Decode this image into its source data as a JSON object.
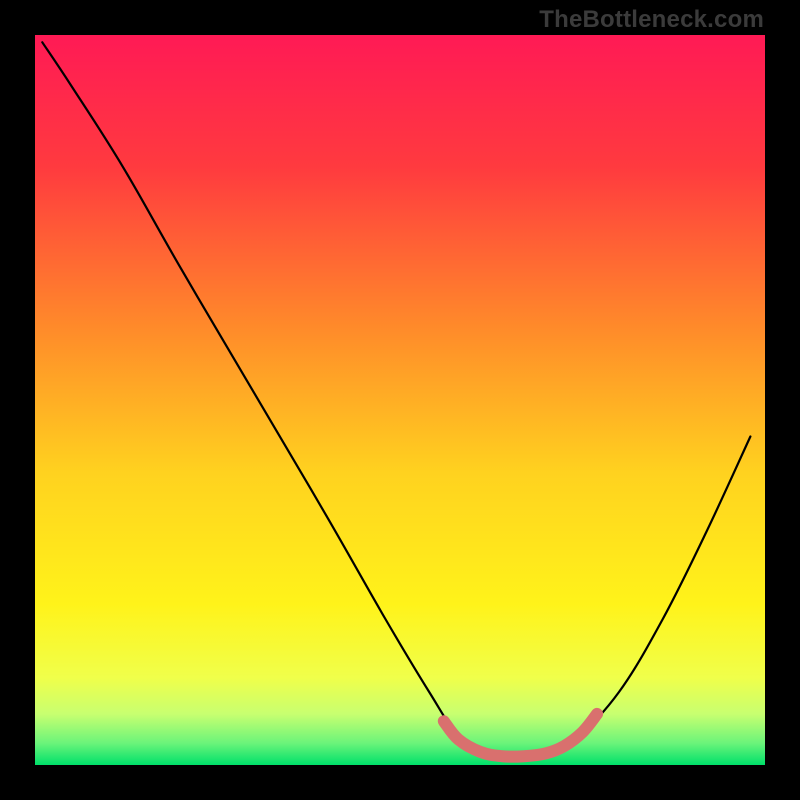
{
  "watermark": "TheBottleneck.com",
  "chart_data": {
    "type": "line",
    "title": "",
    "xlabel": "",
    "ylabel": "",
    "xlim": [
      0,
      100
    ],
    "ylim": [
      0,
      100
    ],
    "gradient_stops": [
      {
        "offset": 0,
        "color": "#ff1a55"
      },
      {
        "offset": 18,
        "color": "#ff3a3f"
      },
      {
        "offset": 40,
        "color": "#ff8a2a"
      },
      {
        "offset": 60,
        "color": "#ffd21f"
      },
      {
        "offset": 78,
        "color": "#fff31a"
      },
      {
        "offset": 88,
        "color": "#f0ff4a"
      },
      {
        "offset": 93,
        "color": "#c8ff70"
      },
      {
        "offset": 97,
        "color": "#6bf47a"
      },
      {
        "offset": 100,
        "color": "#00e06a"
      }
    ],
    "series": [
      {
        "name": "curve",
        "stroke": "#000000",
        "points": [
          {
            "x": 1,
            "y": 99
          },
          {
            "x": 5,
            "y": 93
          },
          {
            "x": 12,
            "y": 82
          },
          {
            "x": 20,
            "y": 68
          },
          {
            "x": 30,
            "y": 51
          },
          {
            "x": 40,
            "y": 34
          },
          {
            "x": 48,
            "y": 20
          },
          {
            "x": 54,
            "y": 10
          },
          {
            "x": 58,
            "y": 4
          },
          {
            "x": 62,
            "y": 1.5
          },
          {
            "x": 66,
            "y": 1
          },
          {
            "x": 70,
            "y": 1.5
          },
          {
            "x": 74,
            "y": 3.5
          },
          {
            "x": 80,
            "y": 10
          },
          {
            "x": 86,
            "y": 20
          },
          {
            "x": 92,
            "y": 32
          },
          {
            "x": 98,
            "y": 45
          }
        ]
      },
      {
        "name": "highlight",
        "stroke": "#d9706e",
        "points": [
          {
            "x": 56,
            "y": 6
          },
          {
            "x": 58,
            "y": 3.5
          },
          {
            "x": 61,
            "y": 1.8
          },
          {
            "x": 64,
            "y": 1.2
          },
          {
            "x": 67,
            "y": 1.2
          },
          {
            "x": 70,
            "y": 1.6
          },
          {
            "x": 72.5,
            "y": 2.6
          },
          {
            "x": 75,
            "y": 4.5
          },
          {
            "x": 77,
            "y": 7
          }
        ]
      }
    ]
  }
}
